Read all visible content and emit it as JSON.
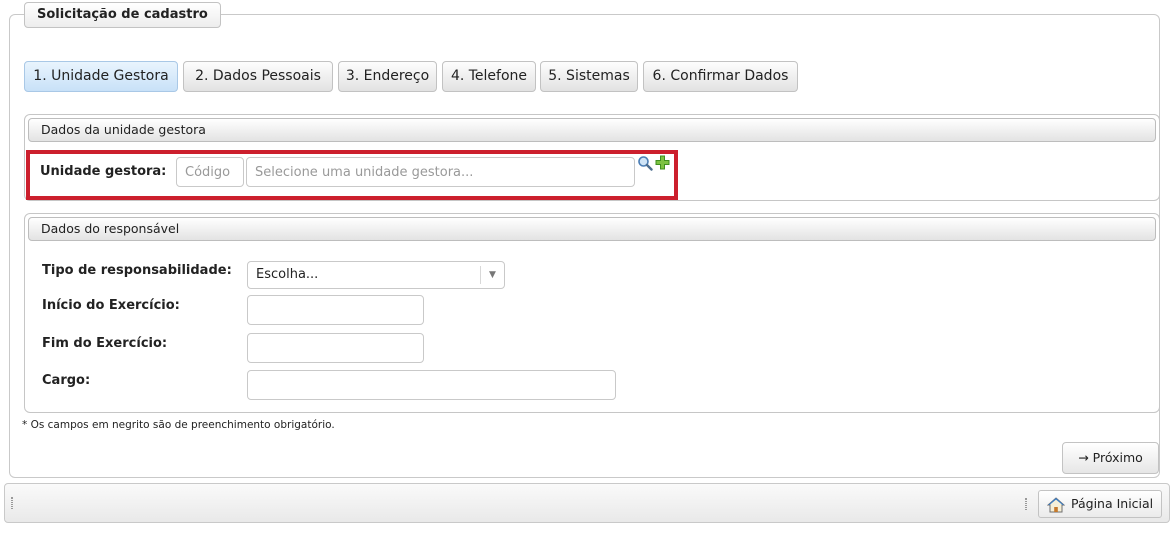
{
  "form": {
    "legend": "Solicitação de cadastro",
    "note": "* Os campos em negrito são de preenchimento obrigatório.",
    "next_button": "→ Próximo"
  },
  "tabs": [
    {
      "label": "1. Unidade Gestora",
      "active": true
    },
    {
      "label": "2. Dados Pessoais",
      "active": false
    },
    {
      "label": "3. Endereço",
      "active": false
    },
    {
      "label": "4. Telefone",
      "active": false
    },
    {
      "label": "5. Sistemas",
      "active": false
    },
    {
      "label": "6. Confirmar Dados",
      "active": false
    }
  ],
  "unidade": {
    "header": "Dados da unidade gestora",
    "label": "Unidade gestora:",
    "code_placeholder": "Código",
    "name_placeholder": "Selecione uma unidade gestora...",
    "icons": [
      "search-icon",
      "add-icon"
    ]
  },
  "responsavel": {
    "header": "Dados do responsável",
    "tipo_label": "Tipo de responsabilidade:",
    "tipo_value": "Escolha...",
    "inicio_label": "Início do Exercício:",
    "fim_label": "Fim do Exercício:",
    "cargo_label": "Cargo:"
  },
  "footer": {
    "home_label": "Página Inicial"
  },
  "colors": {
    "highlight": "#cc1f2d",
    "active_tab": "#c8e1f8"
  }
}
